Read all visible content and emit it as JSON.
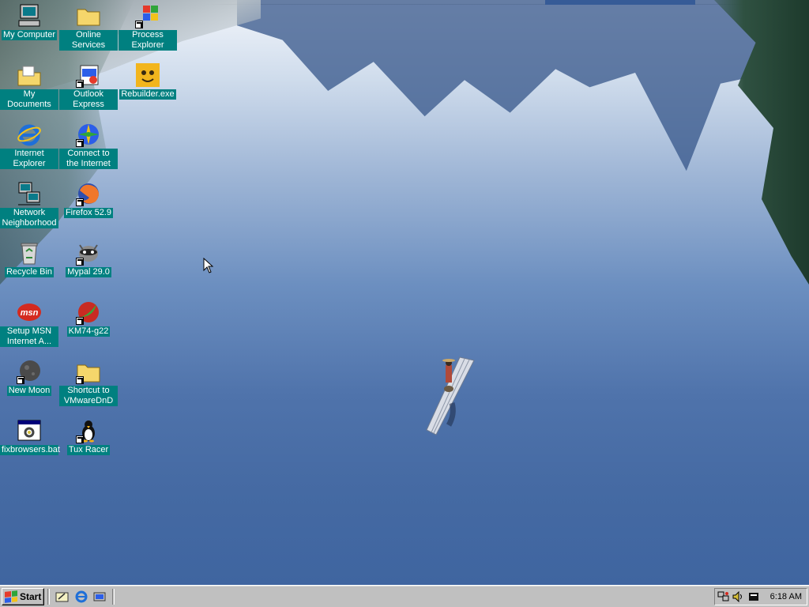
{
  "desktop": {
    "icons": [
      {
        "label": "My Computer",
        "icon": "computer-icon"
      },
      {
        "label": "Online Services",
        "icon": "folder-icon"
      },
      {
        "label": "Process Explorer",
        "icon": "process-explorer-icon"
      },
      {
        "label": "My Documents",
        "icon": "documents-folder-icon"
      },
      {
        "label": "Outlook Express",
        "icon": "outlook-express-icon"
      },
      {
        "label": "Rebuilder.exe",
        "icon": "rebuilder-icon"
      },
      {
        "label": "Internet Explorer",
        "icon": "internet-explorer-icon"
      },
      {
        "label": "Connect to the Internet",
        "icon": "connect-internet-icon"
      },
      {
        "label": "Network Neighborhood",
        "icon": "network-icon"
      },
      {
        "label": "Firefox 52.9",
        "icon": "firefox-icon"
      },
      {
        "label": "Recycle Bin",
        "icon": "recycle-bin-icon"
      },
      {
        "label": "Mypal 29.0",
        "icon": "mypal-icon"
      },
      {
        "label": "Setup MSN Internet A...",
        "icon": "msn-icon"
      },
      {
        "label": "KM74-g22",
        "icon": "km-browser-icon"
      },
      {
        "label": "New Moon",
        "icon": "new-moon-icon"
      },
      {
        "label": "Shortcut to VMwareDnD",
        "icon": "folder-shortcut-icon"
      },
      {
        "label": "fixbrowsers.bat",
        "icon": "batch-file-icon"
      },
      {
        "label": "Tux Racer",
        "icon": "tux-penguin-icon"
      }
    ]
  },
  "taskbar": {
    "start_label": "Start",
    "quick_launch": [
      "show-desktop-icon",
      "internet-explorer-icon",
      "channels-icon"
    ],
    "tray_icons": [
      "network-tray-icon",
      "volume-icon",
      "task-scheduler-icon"
    ],
    "clock": "6:18 AM"
  },
  "colors": {
    "label_bg": "#008080",
    "taskbar": "#c0c0c0"
  }
}
